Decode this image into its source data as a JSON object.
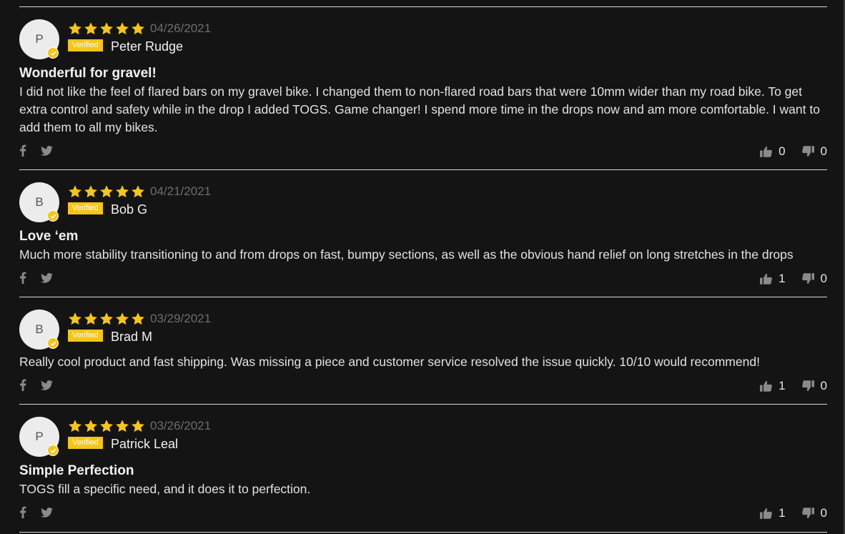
{
  "colors": {
    "star": "#f5c518",
    "badge": "#f5c518",
    "background": "#141414",
    "divider": "#d8d8d8"
  },
  "icons": {
    "share": [
      "facebook-icon",
      "twitter-icon"
    ],
    "votes": [
      "thumbs-up-icon",
      "thumbs-down-icon"
    ],
    "rating": "star-icon",
    "verified": "check-icon"
  },
  "reviews": [
    {
      "initial": "P",
      "rating": 5,
      "date": "04/26/2021",
      "verified_label": "Verified",
      "author": "Peter Rudge",
      "title": "Wonderful for gravel!",
      "body": "I did not like the feel of flared bars on my gravel bike. I changed them to non-flared road bars that were 10mm wider than my road bike. To get extra control and safety while in the drop I added TOGS. Game changer! I spend more time in the drops now and am more comfortable. I want to add them to all my bikes.",
      "upvotes": "0",
      "downvotes": "0"
    },
    {
      "initial": "B",
      "rating": 5,
      "date": "04/21/2021",
      "verified_label": "Verified",
      "author": "Bob G",
      "title": "Love ‘em",
      "body": "Much more stability transitioning to and from drops on fast, bumpy sections, as well as the obvious hand relief on long stretches in the drops",
      "upvotes": "1",
      "downvotes": "0"
    },
    {
      "initial": "B",
      "rating": 5,
      "date": "03/29/2021",
      "verified_label": "Verified",
      "author": "Brad M",
      "title": "",
      "body": "Really cool product and fast shipping. Was missing a piece and customer service resolved the issue quickly. 10/10 would recommend!",
      "upvotes": "1",
      "downvotes": "0"
    },
    {
      "initial": "P",
      "rating": 5,
      "date": "03/26/2021",
      "verified_label": "Verified",
      "author": "Patrick Leal",
      "title": "Simple Perfection",
      "body": "TOGS fill a specific need, and it does it to perfection.",
      "upvotes": "1",
      "downvotes": "0"
    }
  ]
}
